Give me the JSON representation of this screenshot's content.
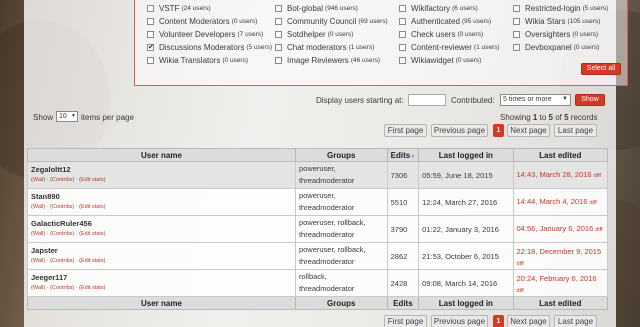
{
  "groups": {
    "col1": [
      {
        "name": "VSTF",
        "count": "(24 users)",
        "checked": false
      },
      {
        "name": "Content Moderators",
        "count": "(0 users)",
        "checked": false
      },
      {
        "name": "Volunteer Developers",
        "count": "(7 users)",
        "checked": false
      },
      {
        "name": "Discussions Moderators",
        "count": "(5 users)",
        "checked": true
      },
      {
        "name": "Wikia Translators",
        "count": "(0 users)",
        "checked": false
      }
    ],
    "col2": [
      {
        "name": "Bot-global",
        "count": "(946 users)",
        "checked": false
      },
      {
        "name": "Community Council",
        "count": "(69 users)",
        "checked": false
      },
      {
        "name": "Sotdhelper",
        "count": "(0 users)",
        "checked": false
      },
      {
        "name": "Chat moderators",
        "count": "(1 users)",
        "checked": false
      },
      {
        "name": "Image Reviewers",
        "count": "(46 users)",
        "checked": false
      }
    ],
    "col3": [
      {
        "name": "Wikifactory",
        "count": "(6 users)",
        "checked": false
      },
      {
        "name": "Authenticated",
        "count": "(95 users)",
        "checked": false
      },
      {
        "name": "Check users",
        "count": "(0 users)",
        "checked": false
      },
      {
        "name": "Content-reviewer",
        "count": "(1 users)",
        "checked": false
      },
      {
        "name": "Wikiawidget",
        "count": "(0 users)",
        "checked": false
      }
    ],
    "col4": [
      {
        "name": "Restricted-login",
        "count": "(5 users)",
        "checked": false
      },
      {
        "name": "Wikia Stars",
        "count": "(105 users)",
        "checked": false
      },
      {
        "name": "Oversighters",
        "count": "(0 users)",
        "checked": false
      },
      {
        "name": "Devboxpanel",
        "count": "(0 users)",
        "checked": false
      }
    ],
    "select_all": "Select all"
  },
  "filter": {
    "display_label": "Display users starting at:",
    "display_value": "",
    "contributed_label": "Contributed:",
    "contributed_value": "5 times or more",
    "show_button": "Show"
  },
  "paging": {
    "show_label": "Show",
    "per_page_value": "10",
    "items_per_page": "items per page",
    "showing_prefix": "Showing",
    "showing_from": "1",
    "showing_to_word": "to",
    "showing_to": "5",
    "showing_of_word": "of",
    "showing_total": "5",
    "showing_suffix": "records",
    "first": "First page",
    "previous": "Previous page",
    "current": "1",
    "next": "Next page",
    "last": "Last page"
  },
  "table": {
    "headers": [
      "User name",
      "Groups",
      "Edits",
      "Last logged in",
      "Last edited"
    ],
    "link_wall": "Wall",
    "link_contribs": "Contribs",
    "link_edit_stats": "Edit stats",
    "diff": "diff",
    "rows": [
      {
        "name": "Zegaloltt12",
        "groups": "poweruser, threadmoderator",
        "edits": "7306",
        "logged": "05:59, June 18, 2015",
        "edited": "14:43, March 28, 2016"
      },
      {
        "name": "Stan890",
        "groups": "poweruser, threadmoderator",
        "edits": "5510",
        "logged": "12:24, March 27, 2016",
        "edited": "14:44, March 4, 2016"
      },
      {
        "name": "GalacticRuler456",
        "groups": "poweruser, rollback, threadmoderator",
        "edits": "3790",
        "logged": "01:22, January 3, 2016",
        "edited": "04:56, January 6, 2016"
      },
      {
        "name": "Japster",
        "groups": "poweruser, rollback, threadmoderator",
        "edits": "2862",
        "logged": "21:53, October 6, 2015",
        "edited": "22:18, December 9, 2015"
      },
      {
        "name": "Jeeger117",
        "groups": "rollback, threadmoderator",
        "edits": "2428",
        "logged": "09:08, March 14, 2016",
        "edited": "20:24, February 6, 2016"
      }
    ]
  }
}
